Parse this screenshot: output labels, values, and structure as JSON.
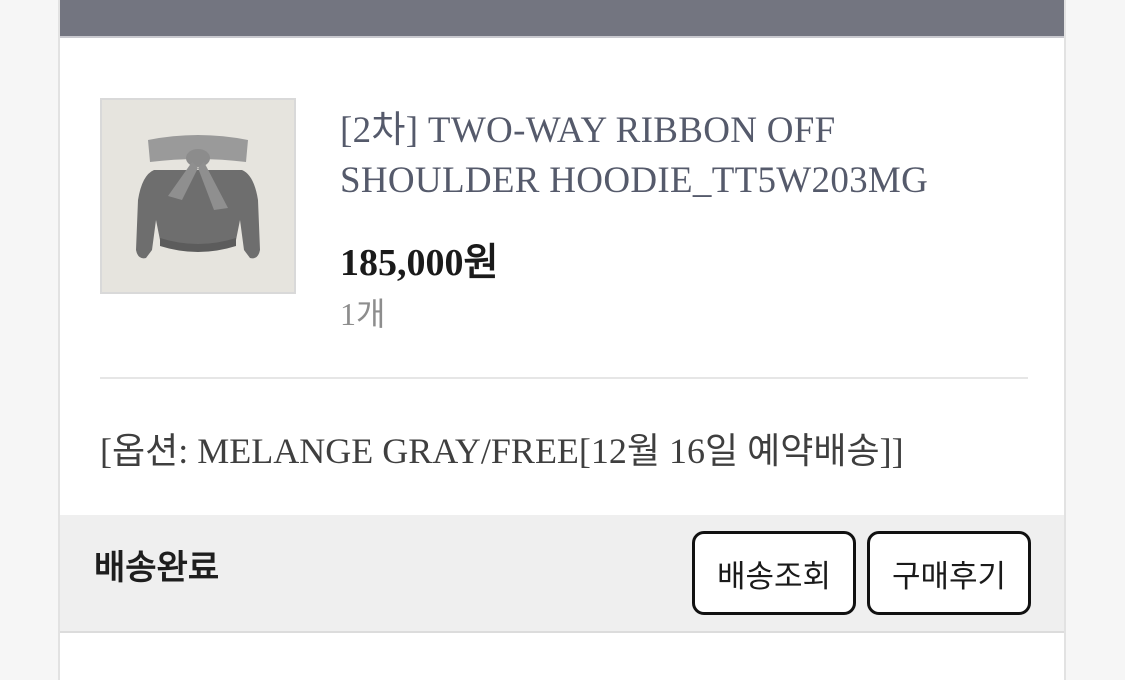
{
  "order_item": {
    "product_name": "[2차] TWO-WAY RIBBON OFF SHOULDER HOODIE_TT5W203MG",
    "price": "185,000원",
    "quantity": "1개",
    "option": "[옵션: MELANGE GRAY/FREE[12월 16일 예약배송]]",
    "image_icon": "hoodie-product-image"
  },
  "delivery": {
    "status": "배송완료",
    "track_label": "배송조회",
    "review_label": "구매후기"
  },
  "colors": {
    "top_bar": "#737580",
    "status_bar_bg": "#efefef",
    "product_name": "#555a6b",
    "button_border": "#111111"
  }
}
